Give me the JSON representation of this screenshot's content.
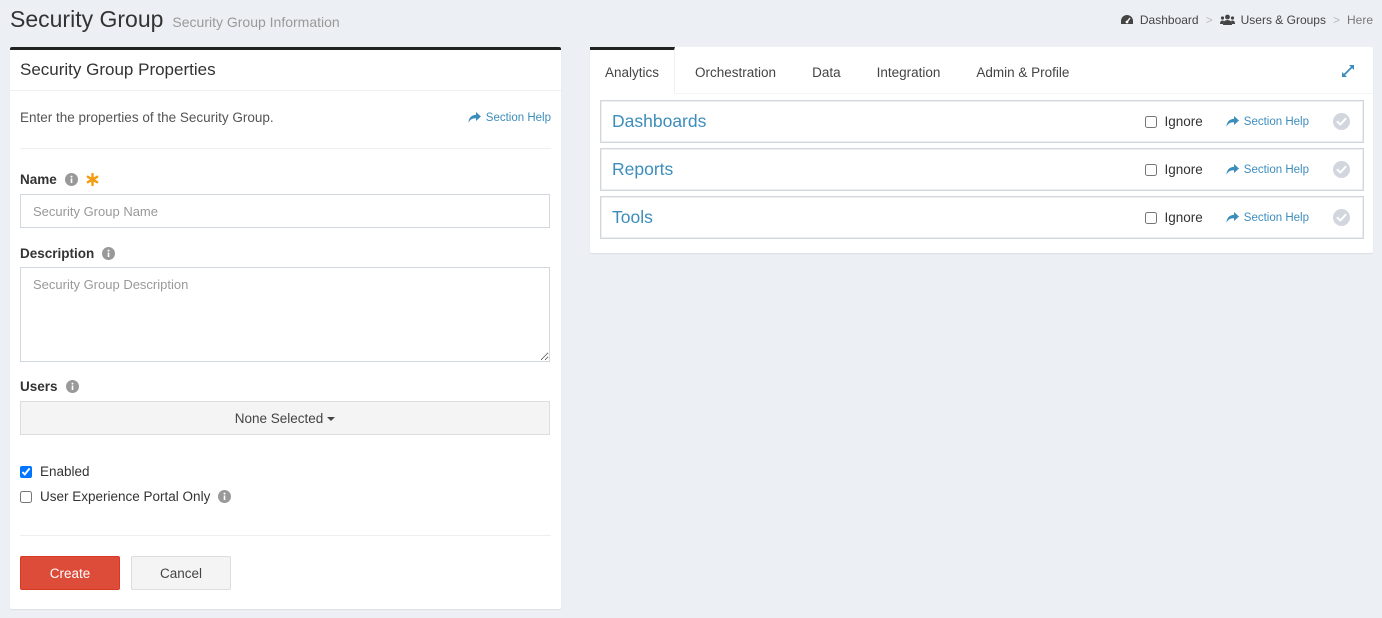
{
  "header": {
    "title": "Security Group",
    "subtitle": "Security Group Information"
  },
  "breadcrumb": {
    "items": [
      {
        "label": "Dashboard",
        "icon": "dashboard-icon"
      },
      {
        "label": "Users & Groups",
        "icon": "users-icon"
      }
    ],
    "separator": ">",
    "current": "Here"
  },
  "properties": {
    "title": "Security Group Properties",
    "intro": "Enter the properties of the Security Group.",
    "section_help": "Section Help",
    "name": {
      "label": "Name",
      "placeholder": "Security Group Name",
      "value": ""
    },
    "description": {
      "label": "Description",
      "placeholder": "Security Group Description",
      "value": ""
    },
    "users": {
      "label": "Users",
      "selected": "None Selected"
    },
    "enabled": {
      "label": "Enabled",
      "checked": true
    },
    "portal_only": {
      "label": "User Experience Portal Only",
      "checked": false
    },
    "create_label": "Create",
    "cancel_label": "Cancel"
  },
  "tabs": [
    {
      "label": "Analytics",
      "active": true
    },
    {
      "label": "Orchestration",
      "active": false
    },
    {
      "label": "Data",
      "active": false
    },
    {
      "label": "Integration",
      "active": false
    },
    {
      "label": "Admin & Profile",
      "active": false
    }
  ],
  "sections": [
    {
      "title": "Dashboards",
      "ignore_label": "Ignore",
      "help_label": "Section Help"
    },
    {
      "title": "Reports",
      "ignore_label": "Ignore",
      "help_label": "Section Help"
    },
    {
      "title": "Tools",
      "ignore_label": "Ignore",
      "help_label": "Section Help"
    }
  ],
  "colors": {
    "accent": "#3c8dbc",
    "danger": "#dd4b39",
    "required": "#f39c12",
    "background": "#ecf0f5"
  }
}
